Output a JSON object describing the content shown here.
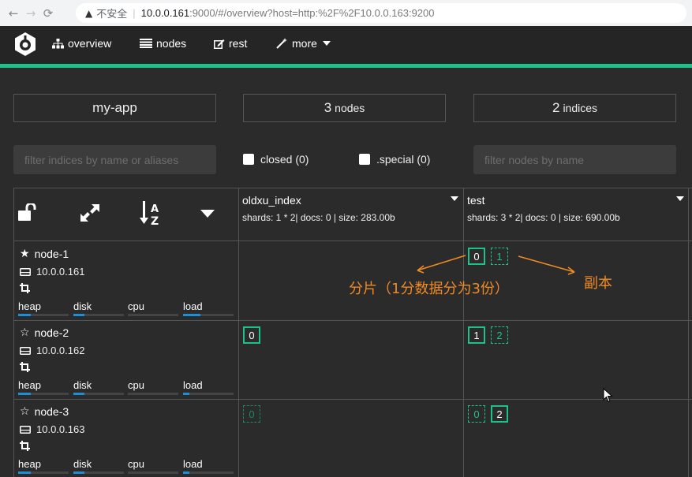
{
  "browser": {
    "insecure_label": "不安全",
    "url_host": "10.0.0.161",
    "url_rest": ":9000/#/overview?host=http:%2F%2F10.0.0.163:9200"
  },
  "navbar": {
    "items": [
      {
        "label": "overview",
        "icon": "sitemap-icon"
      },
      {
        "label": "nodes",
        "icon": "list-icon"
      },
      {
        "label": "rest",
        "icon": "edit-icon"
      },
      {
        "label": "more",
        "icon": "magic-wand-icon"
      }
    ],
    "accent": "#1cc28c"
  },
  "summary": {
    "cluster_name": "my-app",
    "nodes_count": "3",
    "nodes_label": "nodes",
    "indices_count": "2",
    "indices_label": "indices"
  },
  "filters": {
    "indices_placeholder": "filter indices by name or aliases",
    "closed_label": "closed (0)",
    "special_label": ".special (0)",
    "nodes_placeholder": "filter nodes by name"
  },
  "indices": [
    {
      "name": "oldxu_index",
      "meta": "shards: 1 * 2| docs: 0 | size: 283.00b"
    },
    {
      "name": "test",
      "meta": "shards: 3 * 2| docs: 0 | size: 690.00b"
    }
  ],
  "nodes": [
    {
      "name": "node-1",
      "ip": "10.0.0.161",
      "master": true,
      "stats": [
        "heap",
        "disk",
        "cpu",
        "load"
      ],
      "bars": [
        0.25,
        0.22,
        0.0,
        0.35
      ]
    },
    {
      "name": "node-2",
      "ip": "10.0.0.162",
      "master": false,
      "stats": [
        "heap",
        "disk",
        "cpu",
        "load"
      ],
      "bars": [
        0.25,
        0.22,
        0.0,
        0.12
      ]
    },
    {
      "name": "node-3",
      "ip": "10.0.0.163",
      "master": false,
      "stats": [
        "heap",
        "disk",
        "cpu",
        "load"
      ],
      "bars": [
        0.25,
        0.22,
        0.0,
        0.12
      ]
    }
  ],
  "shards": {
    "node1_test": [
      "0",
      "1"
    ],
    "node2_oldxu": [
      "0"
    ],
    "node2_test": [
      "1",
      "2"
    ],
    "node3_oldxu": [
      "0"
    ],
    "node3_test": [
      "0",
      "2"
    ]
  },
  "annotations": {
    "shard_note": "分片（1分数据分为3份）",
    "replica_note": "副本",
    "color": "#f08a24"
  }
}
